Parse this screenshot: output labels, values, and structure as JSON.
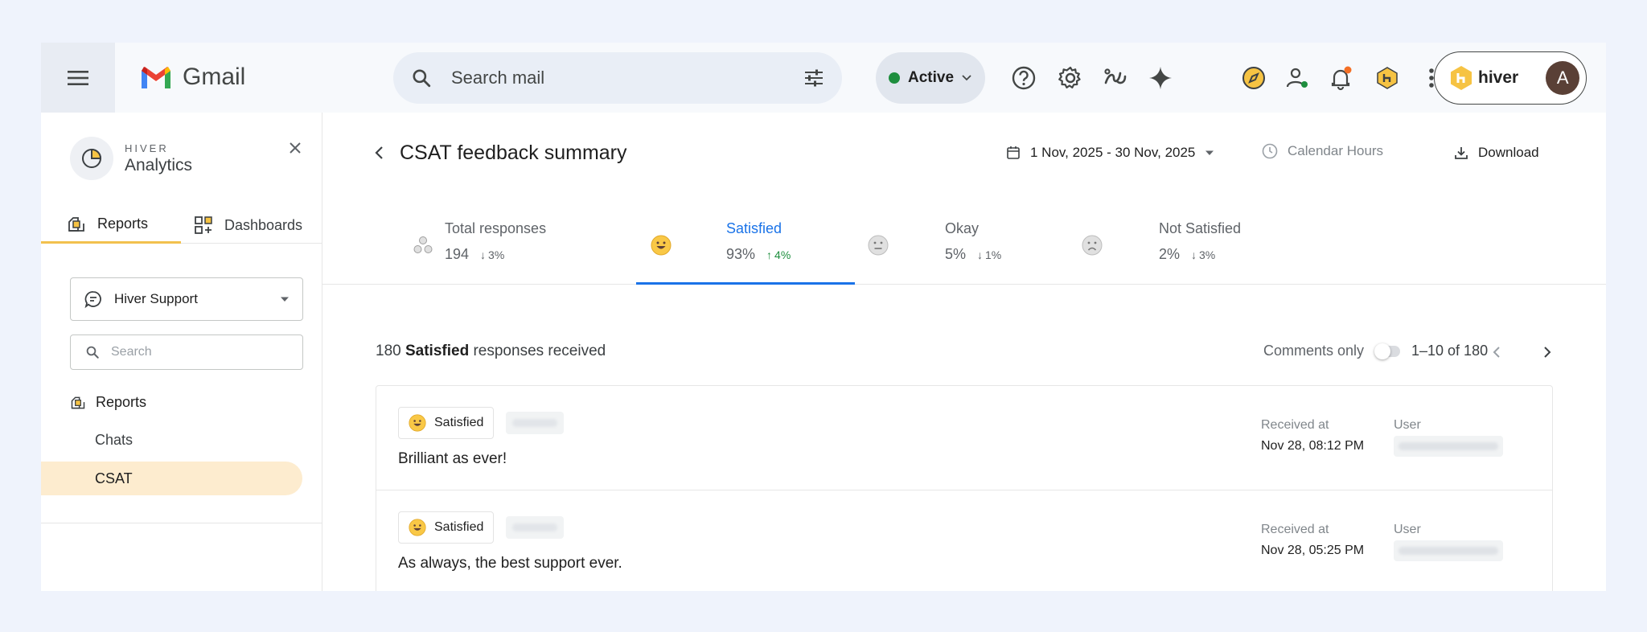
{
  "app": {
    "name": "Gmail"
  },
  "search": {
    "placeholder": "Search mail"
  },
  "status": {
    "label": "Active",
    "color": "#1e8e3e"
  },
  "toolbar_icons": [
    "help-icon",
    "settings-icon",
    "ai-spark-icon",
    "gemini-icon",
    "compass-icon",
    "contacts-icon",
    "notifications-icon",
    "hiver-extension-icon",
    "apps-grid-icon"
  ],
  "account": {
    "brand": "hiver",
    "avatar_letter": "A"
  },
  "sidebar": {
    "brand_top": "HIVER",
    "brand_name": "Analytics",
    "tabs": [
      {
        "label": "Reports"
      },
      {
        "label": "Dashboards"
      }
    ],
    "inbox_selector": "Hiver Support",
    "search_placeholder": "Search",
    "section": "Reports",
    "items": [
      {
        "label": "Chats"
      },
      {
        "label": "CSAT"
      }
    ]
  },
  "main": {
    "title": "CSAT feedback summary",
    "date_range": "1 Nov, 2025 - 30 Nov, 2025",
    "calendar_hours": "Calendar Hours",
    "download": "Download",
    "stats": [
      {
        "name": "Total responses",
        "value": "194",
        "delta": "3%",
        "direction": "down"
      },
      {
        "name": "Satisfied",
        "value": "93%",
        "delta": "4%",
        "direction": "up"
      },
      {
        "name": "Okay",
        "value": "5%",
        "delta": "1%",
        "direction": "down"
      },
      {
        "name": "Not Satisfied",
        "value": "2%",
        "delta": "3%",
        "direction": "down"
      }
    ],
    "responses_count": "180",
    "responses_type": "Satisfied",
    "responses_suffix": "responses received",
    "comments_only": "Comments only",
    "pagination": "1–10 of 180",
    "responses": [
      {
        "rating": "Satisfied",
        "comment": "Brilliant as ever!",
        "received_label": "Received at",
        "received_at": "Nov 28, 08:12 PM",
        "user_label": "User"
      },
      {
        "rating": "Satisfied",
        "comment": "As always, the best support ever.",
        "received_label": "Received at",
        "received_at": "Nov 28, 05:25 PM",
        "user_label": "User"
      }
    ]
  },
  "colors": {
    "accent": "#1a73e8",
    "highlight": "#fdeccf",
    "tab_underline": "#f2c14e",
    "up": "#1e8e3e"
  }
}
